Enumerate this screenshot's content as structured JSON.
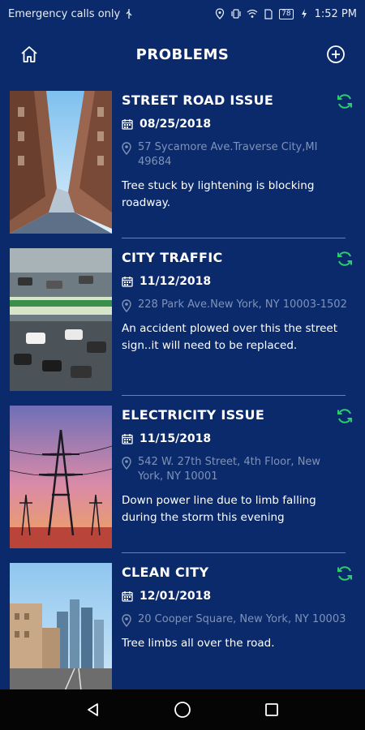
{
  "status_bar": {
    "carrier": "Emergency calls only",
    "battery": "78",
    "time": "1:52 PM"
  },
  "header": {
    "title": "PROBLEMS",
    "home_icon": "home-icon",
    "add_icon": "add-circle-icon"
  },
  "colors": {
    "background": "#0b2a6b",
    "accent_green": "#2ecc71",
    "address_gray": "#7f93b9",
    "divider": "#6c7fa8"
  },
  "problems": [
    {
      "title": "STREET ROAD ISSUE",
      "date": "08/25/2018",
      "address": "57 Sycamore Ave.Traverse City,MI 49684",
      "description": "Tree stuck by lightening is blocking roadway."
    },
    {
      "title": "CITY TRAFFIC",
      "date": "11/12/2018",
      "address": "228 Park Ave.New York, NY 10003-1502",
      "description": "An accident plowed over this the street sign..it will need to be replaced."
    },
    {
      "title": "ELECTRICITY ISSUE",
      "date": "11/15/2018",
      "address": "542 W. 27th Street, 4th Floor, New York, NY 10001",
      "description": "Down power line due to limb falling during the storm this evening"
    },
    {
      "title": "CLEAN CITY",
      "date": "12/01/2018",
      "address": "20 Cooper Square, New York, NY 10003",
      "description": "Tree limbs all over the road."
    }
  ]
}
